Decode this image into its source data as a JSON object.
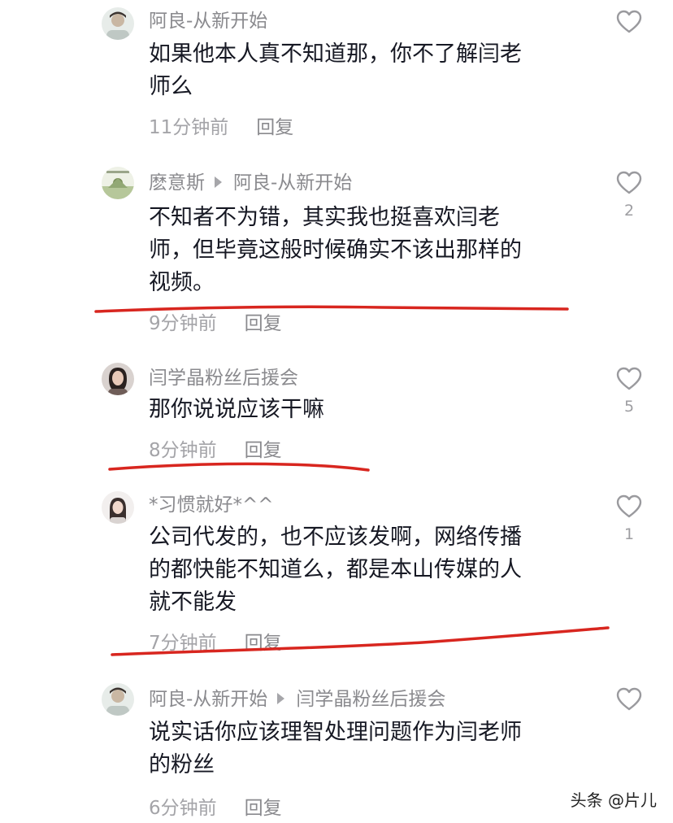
{
  "comments": [
    {
      "author": "阿良-从新开始",
      "reply_to": "",
      "text_lines": [
        "如果他本人真不知道那，你不了解闫老",
        "师么"
      ],
      "time": "11分钟前",
      "reply_label": "回复",
      "likes": ""
    },
    {
      "author": "麽意斯",
      "reply_to": "阿良-从新开始",
      "text_lines": [
        "不知者不为错，其实我也挺喜欢闫老",
        "师，但毕竟这般时候确实不该出那样的",
        "视频。"
      ],
      "time": "9分钟前",
      "reply_label": "回复",
      "likes": "2"
    },
    {
      "author": "闫学晶粉丝后援会",
      "reply_to": "",
      "text_lines": [
        "那你说说应该干嘛"
      ],
      "time": "8分钟前",
      "reply_label": "回复",
      "likes": "5"
    },
    {
      "author": "*习惯就好*^^",
      "reply_to": "",
      "text_lines": [
        "公司代发的，也不应该发啊，网络传播",
        "的都快能不知道么，都是本山传媒的人",
        "就不能发"
      ],
      "time": "7分钟前",
      "reply_label": "回复",
      "likes": "1"
    },
    {
      "author": "阿良-从新开始",
      "reply_to": "闫学晶粉丝后援会",
      "text_lines": [
        "说实话你应该理智处理问题作为闫老师",
        "的粉丝"
      ],
      "time": "6分钟前",
      "reply_label": "回复",
      "likes": ""
    }
  ],
  "watermark": "头条 @片儿",
  "colors": {
    "annotation_red": "#d8261f",
    "author_gray": "#8a8a8e",
    "body_text": "#161823",
    "meta_gray": "#a4a4a8"
  },
  "icons": {
    "like": "heart-outline-icon",
    "reply_to": "triangle-right-icon"
  }
}
